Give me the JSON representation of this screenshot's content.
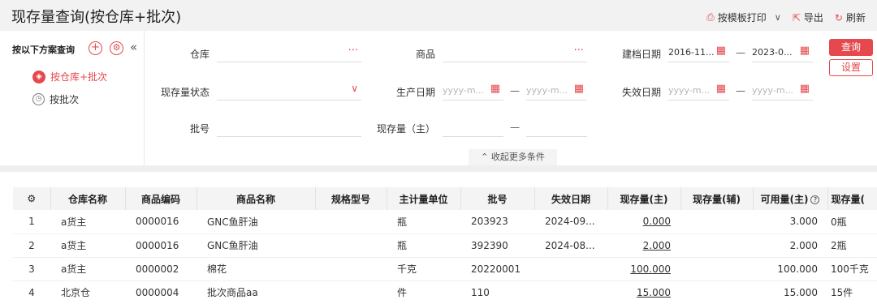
{
  "header": {
    "title": "现存量查询(按仓库+批次)",
    "actions": {
      "print": "按模板打印",
      "export": "导出",
      "refresh": "刷新"
    }
  },
  "scheme": {
    "title": "按以下方案查询",
    "items": [
      {
        "label": "按仓库+批次",
        "active": true
      },
      {
        "label": "按批次",
        "active": false
      }
    ]
  },
  "filters": {
    "warehouse_label": "仓库",
    "product_label": "商品",
    "create_date_label": "建档日期",
    "create_date_from": "2016-11...",
    "create_date_to": "2023-0...",
    "stock_status_label": "现存量状态",
    "prod_date_label": "生产日期",
    "date_placeholder": "yyyy-m...",
    "expire_date_label": "失效日期",
    "batch_label": "批号",
    "qty_main_label": "现存量（主）",
    "dash": "—",
    "more": "收起更多条件"
  },
  "buttons": {
    "query": "查询",
    "settings": "设置"
  },
  "table": {
    "columns": [
      "仓库名称",
      "商品编码",
      "商品名称",
      "规格型号",
      "主计量单位",
      "批号",
      "失效日期",
      "现存量(主)",
      "现存量(辅)",
      "可用量(主)",
      "现存量("
    ],
    "rows": [
      {
        "idx": "1",
        "warehouse": "a货主",
        "code": "0000016",
        "name": "GNC鱼肝油",
        "spec": "",
        "unit": "瓶",
        "batch": "203923",
        "expire": "2024-09...",
        "qty_main": "0.000",
        "qty_aux": "",
        "avail": "3.000",
        "qty_extra": "0瓶"
      },
      {
        "idx": "2",
        "warehouse": "a货主",
        "code": "0000016",
        "name": "GNC鱼肝油",
        "spec": "",
        "unit": "瓶",
        "batch": "392390",
        "expire": "2024-08...",
        "qty_main": "2.000",
        "qty_aux": "",
        "avail": "2.000",
        "qty_extra": "2瓶"
      },
      {
        "idx": "3",
        "warehouse": "a货主",
        "code": "0000002",
        "name": "棉花",
        "spec": "",
        "unit": "千克",
        "batch": "20220001",
        "expire": "",
        "qty_main": "100.000",
        "qty_aux": "",
        "avail": "100.000",
        "qty_extra": "100千克"
      },
      {
        "idx": "4",
        "warehouse": "北京仓",
        "code": "0000004",
        "name": "批次商品aa",
        "spec": "",
        "unit": "件",
        "batch": "110",
        "expire": "",
        "qty_main": "15.000",
        "qty_aux": "",
        "avail": "15.000",
        "qty_extra": "15件"
      }
    ]
  },
  "colors": {
    "accent": "#e5484d",
    "header_bg": "#f2f2f2"
  }
}
